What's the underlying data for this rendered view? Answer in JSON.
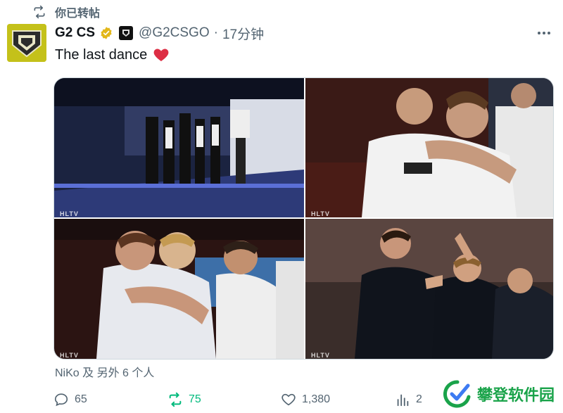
{
  "retweet": {
    "label": "你已转帖",
    "icon": "retweet-icon"
  },
  "author": {
    "name": "G2 CS",
    "handle": "@G2CSGO",
    "separator": "·",
    "time": "17分钟",
    "avatar_icon": "g2-logo",
    "verified_icon": "gold-verified-badge-icon",
    "affiliate_icon": "affiliate-badge-icon"
  },
  "tweet": {
    "text": "The last dance",
    "emoji": "red-heart"
  },
  "media": {
    "photos": [
      {
        "name": "photo-1",
        "watermark": "HLTV"
      },
      {
        "name": "photo-2",
        "watermark": "HLTV"
      },
      {
        "name": "photo-3",
        "watermark": "HLTV"
      },
      {
        "name": "photo-4",
        "watermark": "HLTV"
      }
    ]
  },
  "tagged": {
    "text": "NiKo 及 另外 6 个人"
  },
  "actions": {
    "reply_count": "65",
    "retweet_count": "75",
    "like_count": "1,380",
    "views_count": "2"
  },
  "site_watermark": {
    "text": "攀登软件园"
  },
  "colors": {
    "text_primary": "#0f1419",
    "text_secondary": "#536471",
    "retweet_active": "#00ba7c",
    "verified_gold": "#e2b719",
    "heart_red": "#f4212e"
  }
}
